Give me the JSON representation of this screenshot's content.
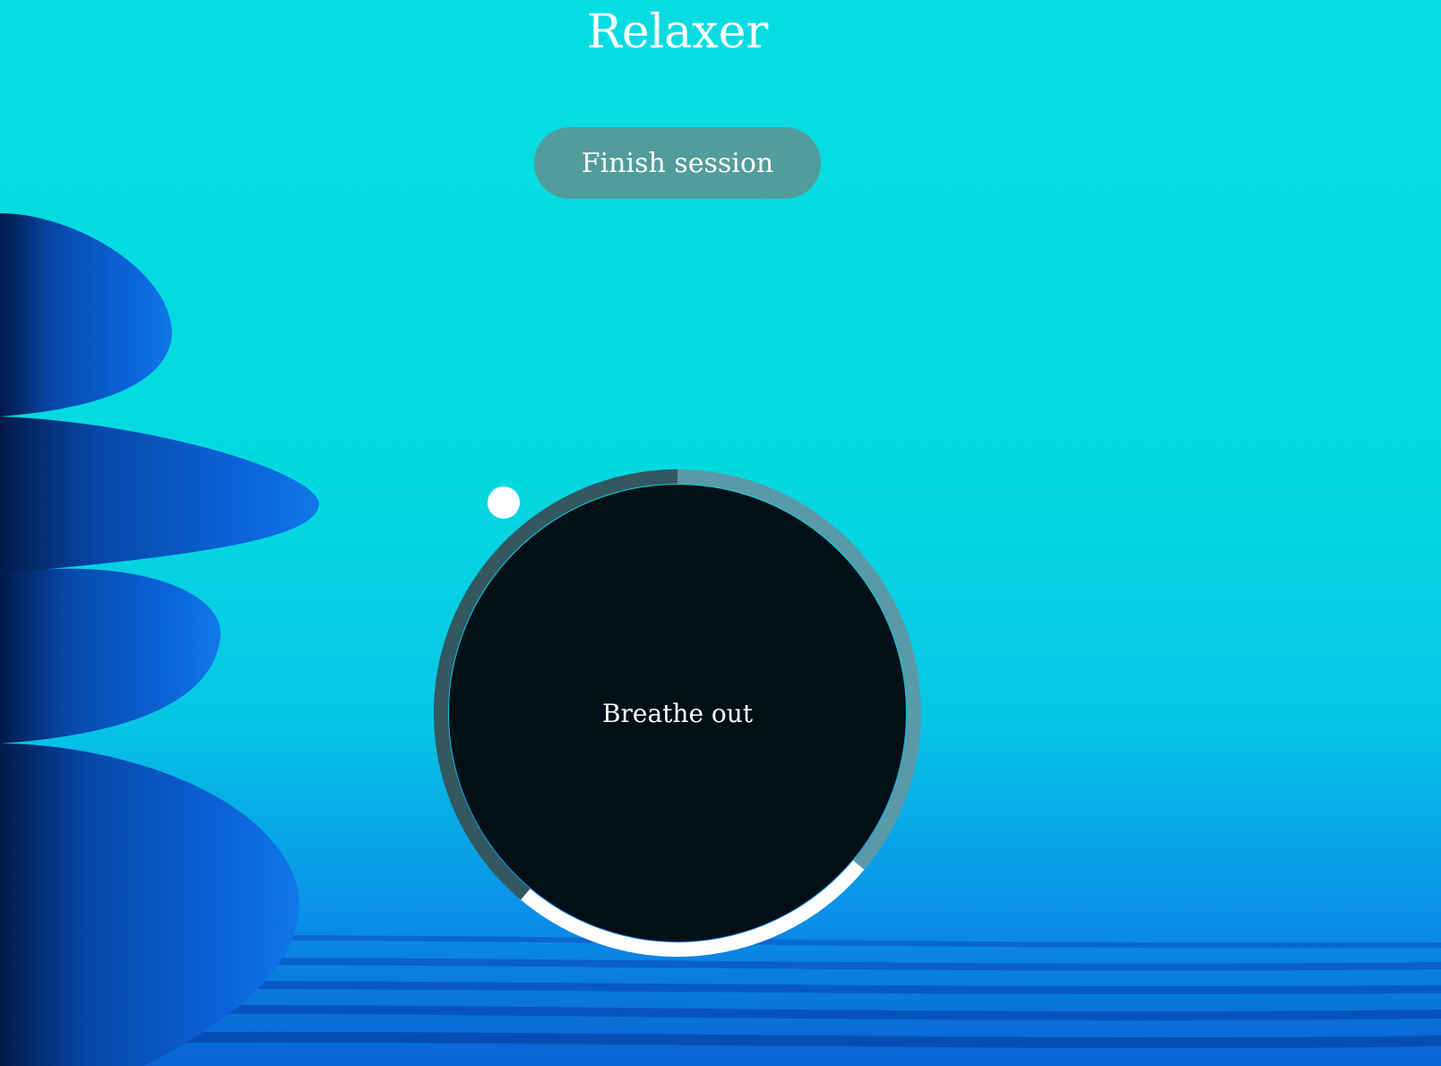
{
  "app": {
    "title": "Relaxer"
  },
  "controls": {
    "finish_label": "Finish session"
  },
  "breathing": {
    "phase_label": "Breathe out",
    "ring_segments": [
      {
        "name": "breathe-in",
        "start_deg": 0,
        "end_deg": 130,
        "color": "#5a9aa8"
      },
      {
        "name": "hold",
        "start_deg": 130,
        "end_deg": 220,
        "color": "#ffffff"
      },
      {
        "name": "breathe-out",
        "start_deg": 220,
        "end_deg": 360,
        "color": "#33585f"
      }
    ],
    "inner_color": "#020f17"
  },
  "colors": {
    "background_top": "#06dde2",
    "background_bottom": "#0a63d2",
    "button_bg": "#539c9c",
    "stone_color": "#0a4fc0"
  },
  "icons": {
    "indicator": "circle-dot"
  }
}
